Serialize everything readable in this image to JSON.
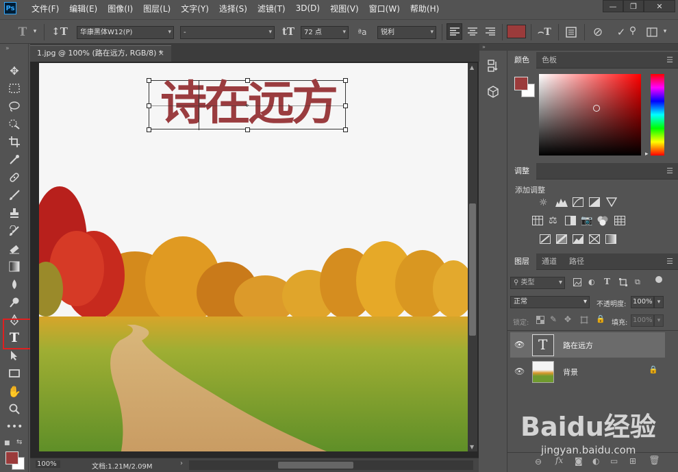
{
  "app": {
    "logo": "Ps",
    "menu": [
      "文件(F)",
      "编辑(E)",
      "图像(I)",
      "图层(L)",
      "文字(Y)",
      "选择(S)",
      "滤镜(T)",
      "3D(D)",
      "视图(V)",
      "窗口(W)",
      "帮助(H)"
    ],
    "window_controls": [
      "—",
      "❐",
      "✕"
    ]
  },
  "options_bar": {
    "font_family": "华康黑体W12(P)",
    "font_style": "-",
    "font_size": "72 点",
    "anti_alias": "锐利",
    "text_color": "#9b3b3b"
  },
  "document": {
    "tab_title": "1.jpg @ 100% (路在远方, RGB/8) *",
    "tab_close": "×",
    "canvas_text": "诗在远方",
    "text_color": "#9a3c3f"
  },
  "status": {
    "zoom": "100%",
    "doc_size": "文档:1.21M/2.09M"
  },
  "color_panel": {
    "tabs": [
      "颜色",
      "色板"
    ],
    "foreground": "#9b3b3b",
    "background": "#ffffff"
  },
  "adjustments_panel": {
    "tab": "调整",
    "add_label": "添加调整",
    "icons": [
      [
        "brightness-icon",
        "levels-icon",
        "curves-icon",
        "exposure-icon",
        "vibrance-icon"
      ],
      [
        "hue-saturation-icon",
        "color-balance-icon",
        "black-white-icon",
        "photo-filter-icon",
        "channel-mixer-icon",
        "color-lookup-icon"
      ],
      [
        "invert-icon",
        "posterize-icon",
        "threshold-icon",
        "selective-color-icon",
        "gradient-map-icon"
      ]
    ]
  },
  "layers_panel": {
    "tabs": [
      "图层",
      "通道",
      "路径"
    ],
    "filter_label": "类型",
    "blend_mode": "正常",
    "opacity_label": "不透明度:",
    "opacity_value": "100%",
    "lock_label": "锁定:",
    "fill_label": "填充:",
    "fill_value": "100%",
    "layers": [
      {
        "name": "路在远方",
        "type": "text",
        "thumb_glyph": "T",
        "selected": true
      },
      {
        "name": "背景",
        "type": "image",
        "locked": true,
        "selected": false
      }
    ]
  },
  "watermark": {
    "brand": "Baidu经验",
    "url": "jingyan.baidu.com"
  }
}
